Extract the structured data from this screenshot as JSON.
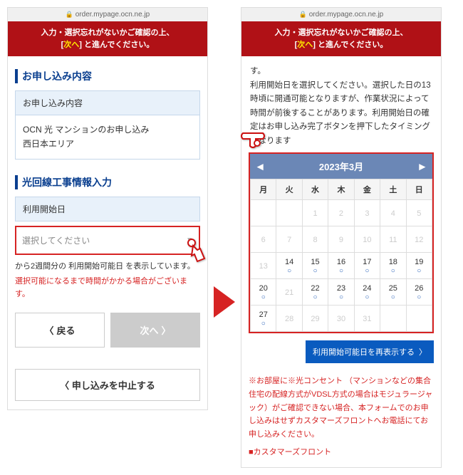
{
  "url": "order.mypage.ocn.ne.jp",
  "warning": {
    "line1": "入力・選択忘れがないかご確認の上、",
    "prefix": "[",
    "next": "次へ",
    "suffix": "] と進んでください。"
  },
  "left": {
    "sec1_title": "お申し込み内容",
    "sec1_label": "お申し込み内容",
    "sec1_body1": "OCN 光 マンションのお申し込み",
    "sec1_body2": "西日本エリア",
    "sec2_title": "光回線工事情報入力",
    "sec2_label": "利用開始日",
    "select_placeholder": "選択してください",
    "note1": "から2週間分の 利用開始可能日 を表示しています。",
    "note2": "選択可能になるまで時間がかかる場合がございます。",
    "btn_back": "戻る",
    "btn_next": "次へ",
    "btn_cancel": "申し込みを中止する"
  },
  "right": {
    "body_top": "す。\n利用開始日を選択してください。選択した日の13時頃に開通可能となりますが、作業状況によって時間が前後することがあります。利用開始日の確定はお申し込み完了ボタンを押下したタイミングになります",
    "cal_title": "2023年3月",
    "dow": [
      "月",
      "火",
      "水",
      "木",
      "金",
      "土",
      "日"
    ],
    "weeks": [
      [
        {
          "d": "",
          "dim": 1
        },
        {
          "d": "",
          "dim": 1
        },
        {
          "d": "1",
          "dim": 1
        },
        {
          "d": "2",
          "dim": 1
        },
        {
          "d": "3",
          "dim": 1
        },
        {
          "d": "4",
          "dim": 1
        },
        {
          "d": "5",
          "dim": 1
        }
      ],
      [
        {
          "d": "6",
          "dim": 1
        },
        {
          "d": "7",
          "dim": 1
        },
        {
          "d": "8",
          "dim": 1
        },
        {
          "d": "9",
          "dim": 1
        },
        {
          "d": "10",
          "dim": 1
        },
        {
          "d": "11",
          "dim": 1
        },
        {
          "d": "12",
          "dim": 1
        }
      ],
      [
        {
          "d": "13",
          "dim": 1
        },
        {
          "d": "14",
          "m": "○"
        },
        {
          "d": "15",
          "m": "○"
        },
        {
          "d": "16",
          "m": "○"
        },
        {
          "d": "17",
          "m": "○"
        },
        {
          "d": "18",
          "m": "○"
        },
        {
          "d": "19",
          "m": "○"
        }
      ],
      [
        {
          "d": "20",
          "m": "○"
        },
        {
          "d": "21",
          "dim": 1
        },
        {
          "d": "22",
          "m": "○"
        },
        {
          "d": "23",
          "m": "○"
        },
        {
          "d": "24",
          "m": "○"
        },
        {
          "d": "25",
          "m": "○"
        },
        {
          "d": "26",
          "m": "○"
        }
      ],
      [
        {
          "d": "27",
          "m": "○",
          "today": 1
        },
        {
          "d": "28",
          "dim": 1
        },
        {
          "d": "29",
          "dim": 1
        },
        {
          "d": "30",
          "dim": 1
        },
        {
          "d": "31",
          "dim": 1
        },
        {
          "d": "",
          "dim": 1
        },
        {
          "d": "",
          "dim": 1
        }
      ]
    ],
    "blue_btn": "利用開始可能日を再表示する",
    "red_note": "※お部屋に※光コンセント （マンションなどの集合住宅の配線方式がVDSL方式の場合はモジュラージャック）がご確認できない場合、本フォームでのお申し込みはせずカスタマーズフロントへお電話にてお申し込みください。",
    "cf_label": "カスタマーズフロント"
  }
}
